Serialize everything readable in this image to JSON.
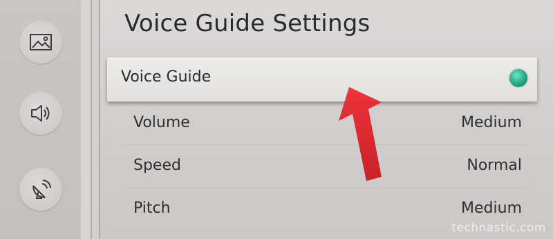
{
  "page_title": "Voice Guide Settings",
  "sidebar": {
    "items": [
      {
        "icon": "picture-icon"
      },
      {
        "icon": "sound-icon"
      },
      {
        "icon": "broadcast-icon"
      }
    ]
  },
  "voice_guide": {
    "label": "Voice Guide",
    "state": "on",
    "indicator_color": "#20a685"
  },
  "settings": [
    {
      "label": "Volume",
      "value": "Medium"
    },
    {
      "label": "Speed",
      "value": "Normal"
    },
    {
      "label": "Pitch",
      "value": "Medium"
    }
  ],
  "colors": {
    "annotation_arrow": "#e8232a"
  },
  "watermark": "technastic.com"
}
